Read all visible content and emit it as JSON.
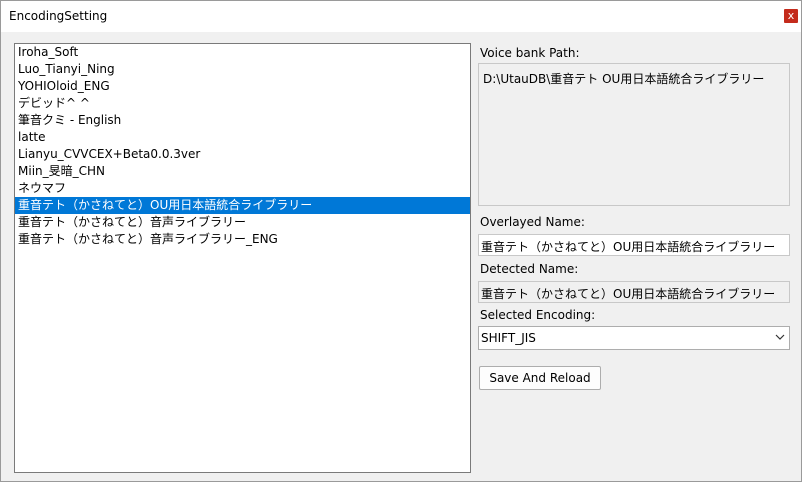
{
  "window": {
    "title": "EncodingSetting",
    "close_glyph": "x"
  },
  "voicebanks": [
    "Iroha_Soft",
    "Luo_Tianyi_Ning",
    "YOHIOloid_ENG",
    "デビッド^ ^",
    "筆音クミ - English",
    "latte",
    "Lianyu_CVVCEX+Beta0.0.3ver",
    "Miin_旻暗_CHN",
    "ネウマフ",
    "重音テト（かさねてと）OU用日本語統合ライブラリー",
    "重音テト（かさねてと）音声ライブラリー",
    "重音テト（かさねてと）音声ライブラリー_ENG"
  ],
  "selected_index": 9,
  "details": {
    "path_label": "Voice bank Path:",
    "path_value": "D:\\UtauDB\\重音テト OU用日本語統合ライブラリー",
    "overlayed_label": "Overlayed Name:",
    "overlayed_value": "重音テト（かさねてと）OU用日本語統合ライブラリー",
    "detected_label": "Detected Name:",
    "detected_value": "重音テト（かさねてと）OU用日本語統合ライブラリー",
    "encoding_label": "Selected Encoding:",
    "encoding_value": "SHIFT_JIS",
    "save_label": "Save And Reload"
  },
  "colors": {
    "selection": "#0078d7",
    "close": "#c42b1c",
    "dialog_bg": "#f0f0f0"
  },
  "icons": {
    "close": "close-icon",
    "dropdown": "chevron-down-icon"
  }
}
